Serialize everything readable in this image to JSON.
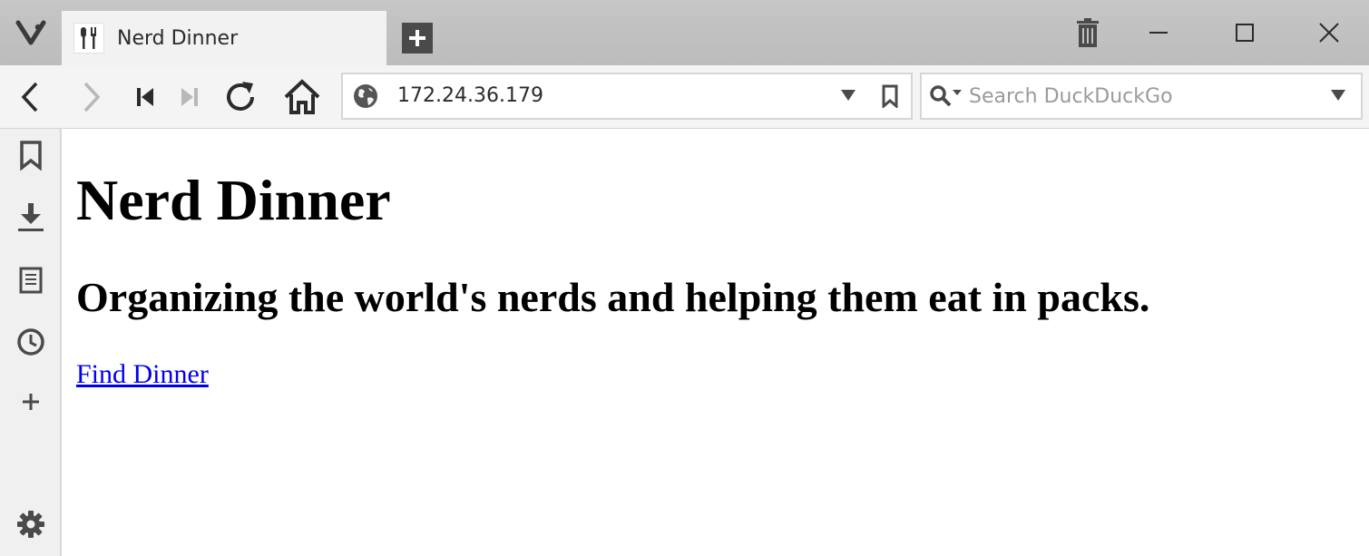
{
  "browser": {
    "tab": {
      "title": "Nerd Dinner",
      "favicon": "fork-knife-icon"
    },
    "address": {
      "url": "172.24.36.179"
    },
    "search": {
      "placeholder": "Search DuckDuckGo"
    },
    "icons": {
      "logo": "vivaldi-logo-icon",
      "new_tab": "plus-icon",
      "trash": "trash-icon",
      "minimize": "minimize-icon",
      "maximize": "maximize-icon",
      "close": "close-icon",
      "back": "back-icon",
      "forward": "forward-icon",
      "rewind": "rewind-icon",
      "fast_forward": "fast-forward-icon",
      "reload": "reload-icon",
      "home": "home-icon",
      "site_info": "globe-icon",
      "url_dropdown": "chevron-down-icon",
      "bookmark_page": "bookmark-icon",
      "search_engine": "search-icon",
      "search_dropdown": "chevron-down-icon"
    },
    "sidepanel": [
      "bookmark-icon",
      "download-icon",
      "notes-icon",
      "history-icon",
      "add-panel-icon",
      "settings-icon"
    ],
    "accent_color": "#bcbcbc"
  },
  "page": {
    "heading": "Nerd Dinner",
    "subheading": "Organizing the world's nerds and helping them eat in packs.",
    "link": "Find Dinner",
    "link_color": "#0000ee"
  }
}
